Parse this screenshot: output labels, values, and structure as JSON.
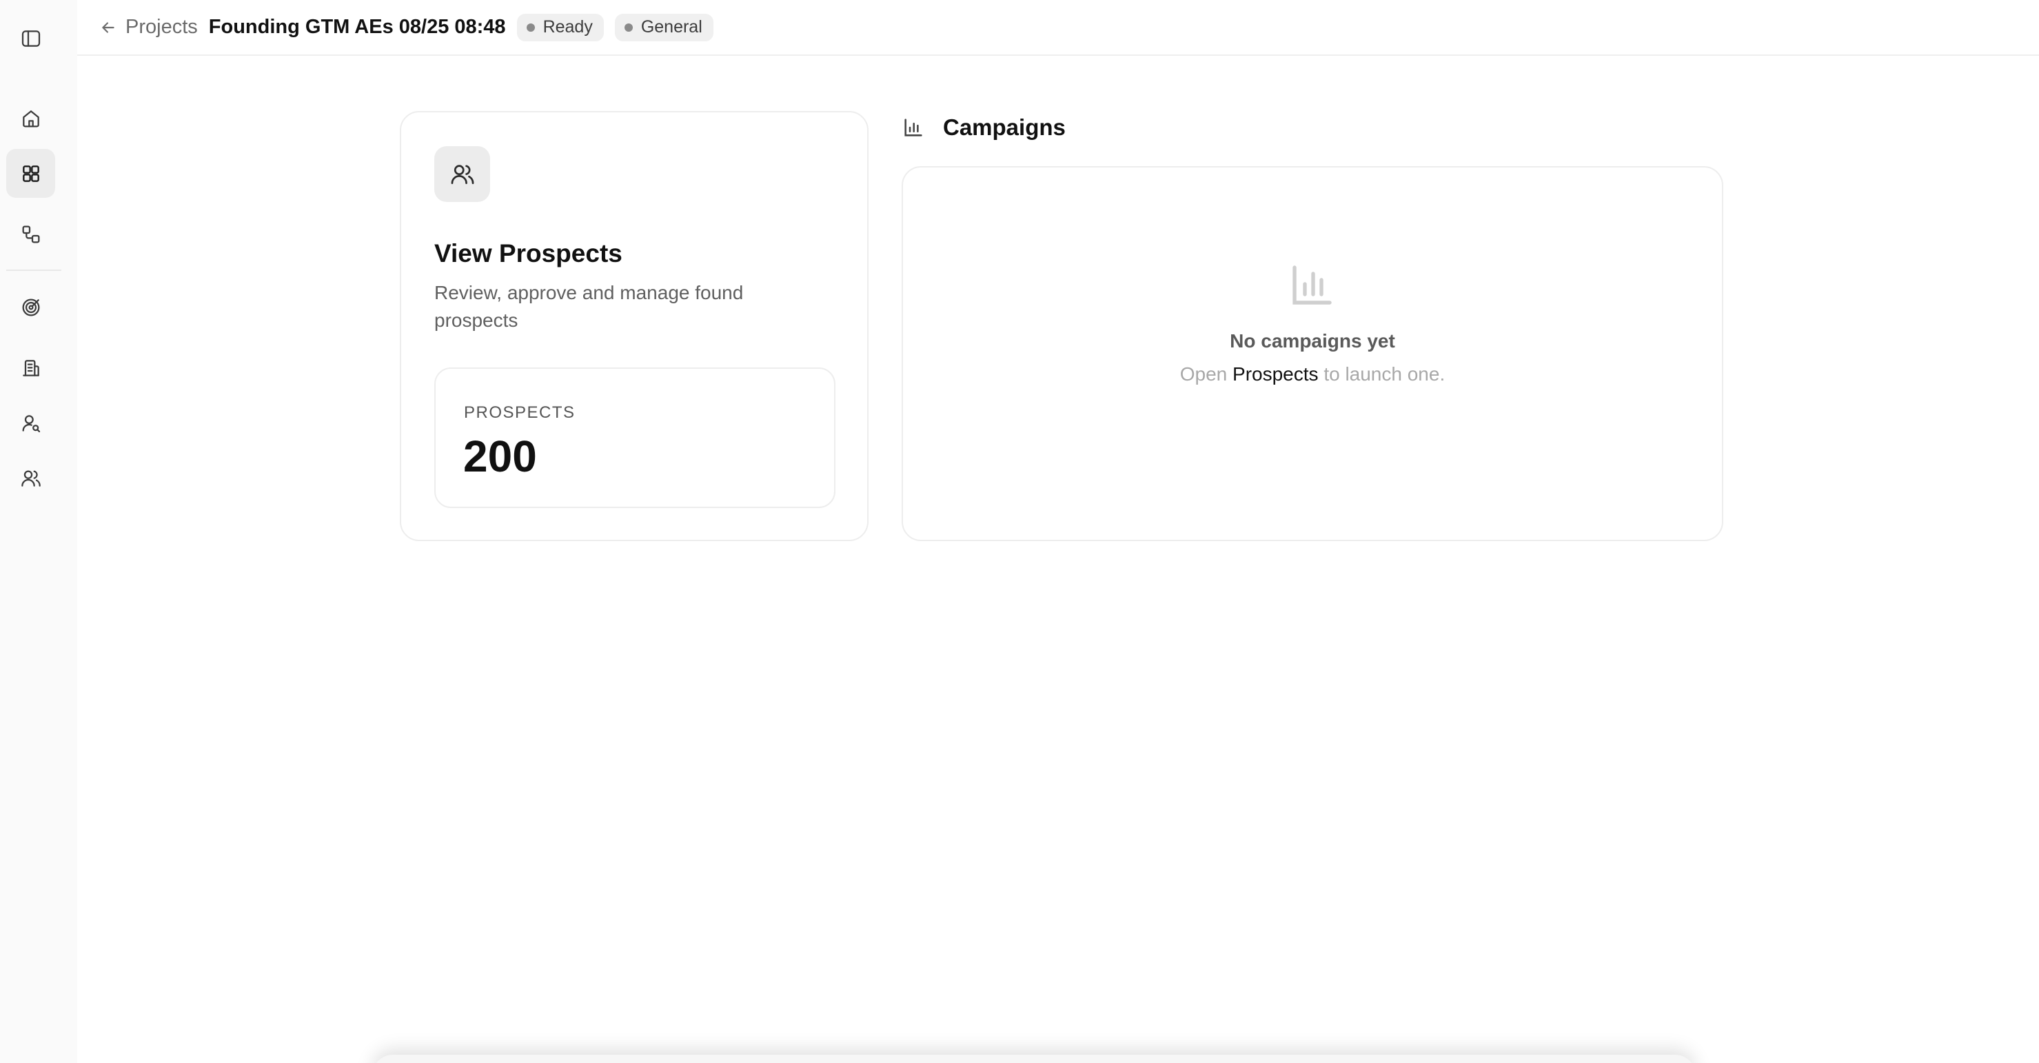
{
  "header": {
    "back_label": "Projects",
    "title": "Founding GTM AEs 08/25 08:48",
    "badges": [
      {
        "label": "Ready"
      },
      {
        "label": "General"
      }
    ]
  },
  "sidebar": {
    "items": [
      {
        "icon": "sidebar-toggle-icon"
      },
      {
        "icon": "home-icon"
      },
      {
        "icon": "grid-icon",
        "active": true
      },
      {
        "icon": "workflow-icon"
      },
      {
        "icon": "target-icon"
      },
      {
        "icon": "building-icon"
      },
      {
        "icon": "user-search-icon"
      },
      {
        "icon": "users-icon"
      }
    ]
  },
  "prospects_card": {
    "icon": "users-icon",
    "title": "View Prospects",
    "description": "Review, approve and manage found prospects",
    "stat_label": "PROSPECTS",
    "stat_value": "200"
  },
  "campaigns": {
    "title": "Campaigns",
    "icon": "bar-chart-icon",
    "empty_title": "No campaigns yet",
    "empty_sub_before": "Open",
    "empty_sub_link": "Prospects",
    "empty_sub_after": "to launch one."
  }
}
